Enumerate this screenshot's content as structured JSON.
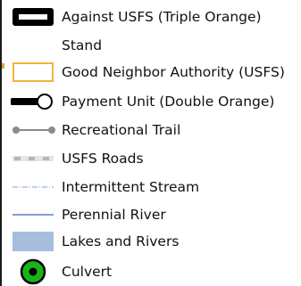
{
  "legend": {
    "items": [
      {
        "symbol": "thick-black-bar",
        "label": "Against USFS (Triple Orange)"
      },
      {
        "symbol": "none",
        "label": "Stand"
      },
      {
        "symbol": "orange-outlined-box",
        "label": "Good Neighbor Authority (USFS)"
      },
      {
        "symbol": "thick-line-open-circle",
        "label": "Payment Unit (Double Orange)"
      },
      {
        "symbol": "gray-line-dot-ends",
        "label": "Recreational Trail"
      },
      {
        "symbol": "gray-dashed-line",
        "label": "USFS Roads"
      },
      {
        "symbol": "thin-dash-dot-blue-line",
        "label": "Intermittent Stream"
      },
      {
        "symbol": "blue-line",
        "label": "Perennial River"
      },
      {
        "symbol": "light-blue-fill",
        "label": "Lakes and Rivers"
      },
      {
        "symbol": "green-circle-black-ring",
        "label": "Culvert"
      }
    ],
    "colors": {
      "outline_orange": "#f2b33d",
      "trail_gray": "#8a8a8a",
      "road_gray": "#b5b5b5",
      "stream_blue": "#8fb3d9",
      "river_blue": "#7aa3d3",
      "lake_fill": "#a5bedd",
      "culvert_green": "#19b41c"
    }
  }
}
